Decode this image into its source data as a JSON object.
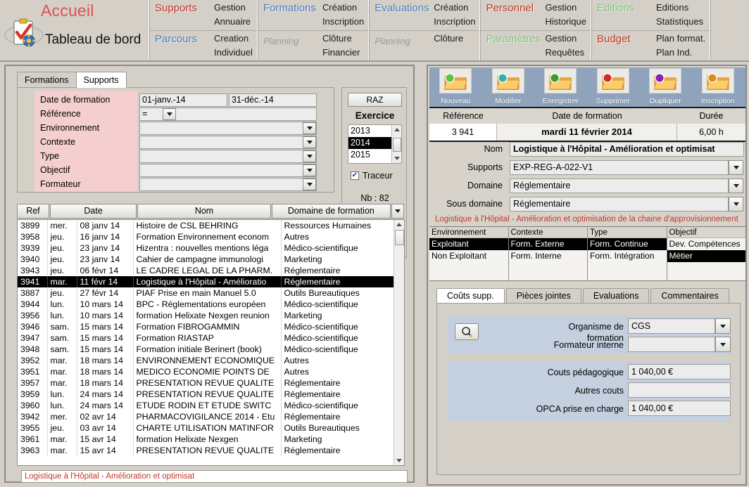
{
  "menu": {
    "logo": {
      "accueil": "Accueil",
      "dashboard": "Tableau de bord",
      "icon": "clipboard-check-icon"
    },
    "groups": [
      {
        "rows": [
          {
            "head": "Supports",
            "head_color": "red",
            "links": [
              "Gestion",
              "Annuaire"
            ]
          },
          {
            "head": "Parcours",
            "head_color": "blue",
            "links": [
              "Creation",
              "Individuel"
            ]
          }
        ]
      },
      {
        "rows": [
          {
            "head": "Formations",
            "head_color": "blue",
            "links": [
              "Création",
              "Inscription"
            ]
          },
          {
            "head": "Planning",
            "head_color": "grey",
            "links": [
              "Clôture",
              "Financier"
            ]
          }
        ]
      },
      {
        "rows": [
          {
            "head": "Evaluations",
            "head_color": "blue",
            "links": [
              "Création",
              "Inscription"
            ]
          },
          {
            "head": "Planning",
            "head_color": "grey",
            "links": [
              "Clôture"
            ]
          }
        ]
      },
      {
        "rows": [
          {
            "head": "Personnel",
            "head_color": "red",
            "links": [
              "Gestion",
              "Historique"
            ]
          },
          {
            "head": "Paramètres",
            "head_color": "green",
            "links": [
              "Gestion",
              "Requêtes"
            ]
          }
        ]
      },
      {
        "rows": [
          {
            "head": "Editions",
            "head_color": "green",
            "links": [
              "Editions",
              "Statistiques"
            ]
          },
          {
            "head": "Budget",
            "head_color": "red",
            "links": [
              "Plan format.",
              "Plan Ind."
            ]
          }
        ]
      }
    ]
  },
  "left": {
    "tabs": [
      {
        "label": "Formations",
        "active": false
      },
      {
        "label": "Supports",
        "active": true
      }
    ],
    "filters": [
      {
        "label": "Date de formation",
        "value": "01-janv.-14",
        "value2": "31-déc.-14",
        "type": "date-range"
      },
      {
        "label": "Référence",
        "value": "=",
        "type": "operator"
      },
      {
        "label": "Environnement",
        "value": "",
        "type": "combo"
      },
      {
        "label": "Contexte",
        "value": "",
        "type": "combo"
      },
      {
        "label": "Type",
        "value": "",
        "type": "combo"
      },
      {
        "label": "Objectif",
        "value": "",
        "type": "combo"
      },
      {
        "label": "Formateur",
        "value": "",
        "type": "combo"
      }
    ],
    "exercice": {
      "raz_label": "RAZ",
      "title": "Exercice",
      "years": [
        "2013",
        "2014",
        "2015"
      ],
      "selected_year": "2014",
      "traceur_label": "Traceur",
      "traceur_checked": true,
      "count_label": "Nb : 82"
    },
    "table": {
      "columns": [
        "Ref",
        "Date",
        "Nom",
        "Domaine de formation"
      ],
      "rows": [
        {
          "ref": "3899",
          "day": "mer.",
          "date": "08 janv 14",
          "nom": "Histoire de CSL BEHRING",
          "domaine": "Ressources Humaines",
          "selected": false
        },
        {
          "ref": "3958",
          "day": "jeu.",
          "date": "16 janv 14",
          "nom": "Formation Environnement econom",
          "domaine": "Autres",
          "selected": false
        },
        {
          "ref": "3939",
          "day": "jeu.",
          "date": "23 janv 14",
          "nom": "Hizentra : nouvelles mentions léga",
          "domaine": "Médico-scientifique",
          "selected": false
        },
        {
          "ref": "3940",
          "day": "jeu.",
          "date": "23 janv 14",
          "nom": "Cahier de campagne immunologi",
          "domaine": "Marketing",
          "selected": false
        },
        {
          "ref": "3943",
          "day": "jeu.",
          "date": "06 févr 14",
          "nom": "LE CADRE LEGAL DE LA PHARM.",
          "domaine": "Réglementaire",
          "selected": false
        },
        {
          "ref": "3941",
          "day": "mar.",
          "date": "11 févr 14",
          "nom": "Logistique à l'Hôpital - Amélioratio",
          "domaine": "Réglementaire",
          "selected": true
        },
        {
          "ref": "3887",
          "day": "jeu.",
          "date": "27 févr 14",
          "nom": "PIAF Prise en main Manuel 5.0",
          "domaine": "Outils Bureautiques",
          "selected": false
        },
        {
          "ref": "3944",
          "day": "lun.",
          "date": "10 mars 14",
          "nom": "BPC - Réglementations européen",
          "domaine": "Médico-scientifique",
          "selected": false
        },
        {
          "ref": "3956",
          "day": "lun.",
          "date": "10 mars 14",
          "nom": "formation Helixate Nexgen reunion",
          "domaine": "Marketing",
          "selected": false
        },
        {
          "ref": "3946",
          "day": "sam.",
          "date": "15 mars 14",
          "nom": "Formation FIBROGAMMIN",
          "domaine": "Médico-scientifique",
          "selected": false
        },
        {
          "ref": "3947",
          "day": "sam.",
          "date": "15 mars 14",
          "nom": "Formation RIASTAP",
          "domaine": "Médico-scientifique",
          "selected": false
        },
        {
          "ref": "3948",
          "day": "sam.",
          "date": "15 mars 14",
          "nom": "Formation initiale Berinert (book)",
          "domaine": "Médico-scientifique",
          "selected": false
        },
        {
          "ref": "3952",
          "day": "mar.",
          "date": "18 mars 14",
          "nom": "ENVIRONNEMENT ECONOMIQUE",
          "domaine": "Autres",
          "selected": false
        },
        {
          "ref": "3951",
          "day": "mar.",
          "date": "18 mars 14",
          "nom": "MEDICO ECONOMIE POINTS DE",
          "domaine": "Autres",
          "selected": false
        },
        {
          "ref": "3957",
          "day": "mar.",
          "date": "18 mars 14",
          "nom": "PRESENTATION REVUE QUALITE",
          "domaine": "Réglementaire",
          "selected": false
        },
        {
          "ref": "3959",
          "day": "lun.",
          "date": "24 mars 14",
          "nom": "PRESENTATION REVUE QUALITE",
          "domaine": "Réglementaire",
          "selected": false
        },
        {
          "ref": "3960",
          "day": "lun.",
          "date": "24 mars 14",
          "nom": "ETUDE RODIN ET ETUDE SWITC",
          "domaine": "Médico-scientifique",
          "selected": false
        },
        {
          "ref": "3942",
          "day": "mer.",
          "date": "02 avr 14",
          "nom": "PHARMACOVIGILANCE 2014 - Etu",
          "domaine": "Réglementaire",
          "selected": false
        },
        {
          "ref": "3955",
          "day": "jeu.",
          "date": "03 avr 14",
          "nom": "CHARTE UTILISATION MATINFOR",
          "domaine": "Outils Bureautiques",
          "selected": false
        },
        {
          "ref": "3961",
          "day": "mar.",
          "date": "15 avr 14",
          "nom": "formation Helixate Nexgen",
          "domaine": "Marketing",
          "selected": false
        },
        {
          "ref": "3963",
          "day": "mar.",
          "date": "15 avr 14",
          "nom": "PRESENTATION REVUE QUALITE",
          "domaine": "Réglementaire",
          "selected": false
        }
      ]
    },
    "status": "Logistique à l'Hôpital - Amélioration et optimisat"
  },
  "right": {
    "toolbar": [
      {
        "label": "Nouveau",
        "icon": "folder-add-icon",
        "badge_color": "#5fbf4d"
      },
      {
        "label": "Modifier",
        "icon": "folder-refresh-icon",
        "badge_color": "#2fb3a8"
      },
      {
        "label": "Enregistrer",
        "icon": "folder-save-icon",
        "badge_color": "#3f9b2f"
      },
      {
        "label": "Supprimer",
        "icon": "folder-delete-icon",
        "badge_color": "#d02b2b"
      },
      {
        "label": "Dupliquer",
        "icon": "folder-duplicate-icon",
        "badge_color": "#8a21b5"
      },
      {
        "label": "Inscription",
        "icon": "folder-inscription-icon",
        "badge_color": "#e08a1e"
      }
    ],
    "header": {
      "columns": [
        "Référence",
        "Date de formation",
        "Durée"
      ],
      "values": [
        "3 941",
        "mardi 11 février 2014",
        "6,00 h"
      ]
    },
    "form": [
      {
        "label": "Nom",
        "value": "Logistique à l'Hôpital - Amélioration et optimisat",
        "combo": false
      },
      {
        "label": "Supports",
        "value": "EXP-REG-A-022-V1",
        "combo": true
      },
      {
        "label": "Domaine",
        "value": "Réglementaire",
        "combo": true
      },
      {
        "label": "Sous domaine",
        "value": "Réglementaire",
        "combo": true
      }
    ],
    "subtitle": "Logistique à l'Hôpital - Amélioration et optimisation de la chaine d'approvisionnement",
    "quad": [
      {
        "header": "Environnement",
        "items": [
          {
            "label": "Exploitant",
            "selected": true
          },
          {
            "label": "Non Exploitant",
            "selected": false
          }
        ]
      },
      {
        "header": "Contexte",
        "items": [
          {
            "label": "Form. Externe",
            "selected": true
          },
          {
            "label": "Form. Interne",
            "selected": false
          }
        ]
      },
      {
        "header": "Type",
        "items": [
          {
            "label": "Form. Continue",
            "selected": true
          },
          {
            "label": "Form. Intégration",
            "selected": false
          }
        ]
      },
      {
        "header": "Objectif",
        "items": [
          {
            "label": "Dev. Compétences",
            "selected": false
          },
          {
            "label": "Métier",
            "selected": true
          }
        ]
      }
    ],
    "tabs": [
      {
        "label": "Coûts supp.",
        "active": true
      },
      {
        "label": "Pièces jointes",
        "active": false
      },
      {
        "label": "Evaluations",
        "active": false
      },
      {
        "label": "Commentaires",
        "active": false
      }
    ],
    "costs": {
      "search_icon": "magnifier-icon",
      "organisme_label_line1": "Organisme de",
      "organisme_label_line2": "formation",
      "organisme_value": "CGS",
      "formateur_label": "Formateur interne",
      "formateur_value": "",
      "fields": [
        {
          "label": "Couts pédagogique",
          "value": "1 040,00 €"
        },
        {
          "label": "Autres couts",
          "value": ""
        },
        {
          "label": "OPCA prise en charge",
          "value": "1 040,00 €"
        }
      ]
    }
  }
}
